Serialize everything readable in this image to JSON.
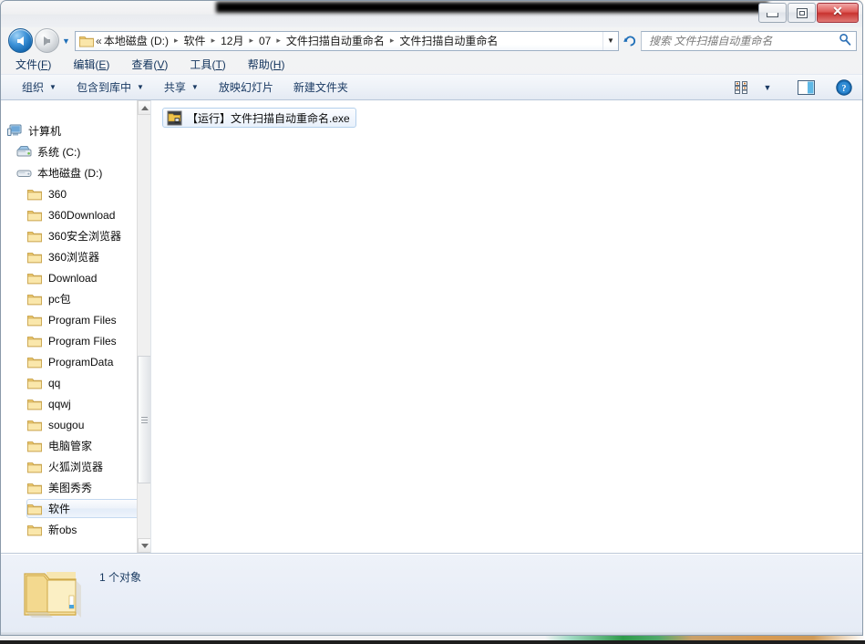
{
  "window": {
    "title_redacted": true,
    "controls": {
      "minimize_label": "最小化",
      "maximize_label": "还原",
      "close_label": "✕"
    }
  },
  "navigation": {
    "back_label": "后退",
    "forward_label": "前进",
    "history_label": "▼",
    "refresh_label": "刷新"
  },
  "address": {
    "prev_glyph": "«",
    "separator": "▸",
    "dropdown_glyph": "▼",
    "breadcrumb": [
      "本地磁盘 (D:)",
      "软件",
      "12月",
      "07",
      "文件扫描自动重命名",
      "文件扫描自动重命名"
    ]
  },
  "search": {
    "placeholder": "搜索 文件扫描自动重命名",
    "icon": "search-icon"
  },
  "menubar": {
    "items": [
      {
        "label": "文件",
        "accel": "F"
      },
      {
        "label": "编辑",
        "accel": "E"
      },
      {
        "label": "查看",
        "accel": "V"
      },
      {
        "label": "工具",
        "accel": "T"
      },
      {
        "label": "帮助",
        "accel": "H"
      }
    ]
  },
  "toolbar": {
    "organize_label": "组织",
    "include_library_label": "包含到库中",
    "share_label": "共享",
    "slideshow_label": "放映幻灯片",
    "new_folder_label": "新建文件夹",
    "caret": "▼",
    "view_options_icon": "view-options-icon",
    "preview_pane_icon": "preview-pane-icon",
    "help_icon": "help-icon",
    "help_glyph": "?"
  },
  "nav_pane": {
    "items": [
      {
        "label": "计算机",
        "icon": "computer-icon",
        "indent": 0,
        "selected": false
      },
      {
        "label": "系统 (C:)",
        "icon": "drive-system-icon",
        "indent": 1,
        "selected": false
      },
      {
        "label": "本地磁盘 (D:)",
        "icon": "drive-icon",
        "indent": 1,
        "selected": false
      },
      {
        "label": "360",
        "icon": "folder-icon",
        "indent": 2,
        "selected": false
      },
      {
        "label": "360Download",
        "icon": "folder-icon",
        "indent": 2,
        "selected": false
      },
      {
        "label": "360安全浏览器",
        "icon": "folder-icon",
        "indent": 2,
        "selected": false
      },
      {
        "label": "360浏览器",
        "icon": "folder-icon",
        "indent": 2,
        "selected": false
      },
      {
        "label": "Download",
        "icon": "folder-icon",
        "indent": 2,
        "selected": false
      },
      {
        "label": "pc包",
        "icon": "folder-icon",
        "indent": 2,
        "selected": false
      },
      {
        "label": "Program Files",
        "icon": "folder-icon",
        "indent": 2,
        "selected": false
      },
      {
        "label": "Program Files",
        "icon": "folder-icon",
        "indent": 2,
        "selected": false
      },
      {
        "label": "ProgramData",
        "icon": "folder-icon",
        "indent": 2,
        "selected": false
      },
      {
        "label": "qq",
        "icon": "folder-icon",
        "indent": 2,
        "selected": false
      },
      {
        "label": "qqwj",
        "icon": "folder-icon",
        "indent": 2,
        "selected": false
      },
      {
        "label": "sougou",
        "icon": "folder-icon",
        "indent": 2,
        "selected": false
      },
      {
        "label": "电脑管家",
        "icon": "folder-icon",
        "indent": 2,
        "selected": false
      },
      {
        "label": "火狐浏览器",
        "icon": "folder-icon",
        "indent": 2,
        "selected": false
      },
      {
        "label": "美图秀秀",
        "icon": "folder-icon",
        "indent": 2,
        "selected": false
      },
      {
        "label": "软件",
        "icon": "folder-icon",
        "indent": 2,
        "selected": true
      },
      {
        "label": "新obs",
        "icon": "folder-icon",
        "indent": 2,
        "selected": false
      }
    ],
    "scrollbar": {
      "up_glyph": "▲",
      "down_glyph": "▼"
    }
  },
  "file_list": {
    "items": [
      {
        "name": "【运行】文件扫描自动重命名.exe",
        "icon": "exe-file-icon",
        "selected": true
      }
    ]
  },
  "details": {
    "icon": "open-folder-icon",
    "count_text": "1 个对象"
  },
  "colors": {
    "accent_blue": "#1f6fb8",
    "selection_border": "#b4d0ec",
    "menu_text": "#12335c",
    "close_red": "#c8322f",
    "folder_yellow": "#f5d88a"
  }
}
